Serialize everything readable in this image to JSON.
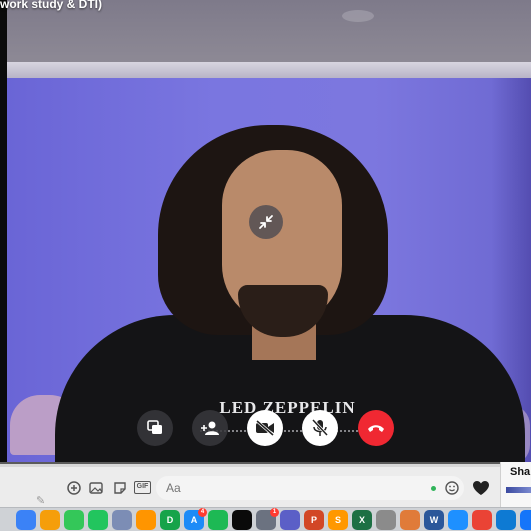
{
  "call": {
    "title_fragment": "work study & DTI)"
  },
  "shirt": {
    "print_text": "LED ZEPPELIN"
  },
  "composer": {
    "placeholder": "Aa"
  },
  "side_panel": {
    "label": "Sha"
  },
  "colors": {
    "end_call": "#f02832",
    "wall": "#7a76e0",
    "online": "#31b45a"
  },
  "dock": {
    "apps": [
      {
        "name": "finder-icon",
        "color": "#3b82f6",
        "glyph": ""
      },
      {
        "name": "photos-icon",
        "color": "#f59e0b",
        "glyph": ""
      },
      {
        "name": "messages-icon",
        "color": "#34c759",
        "glyph": ""
      },
      {
        "name": "facetime-icon",
        "color": "#22c55e",
        "glyph": ""
      },
      {
        "name": "preview-icon",
        "color": "#7c8db5",
        "glyph": ""
      },
      {
        "name": "books-icon",
        "color": "#ff9500",
        "glyph": ""
      },
      {
        "name": "numbers-icon",
        "color": "#16a34a",
        "glyph": "D"
      },
      {
        "name": "app-store-icon",
        "color": "#1d8bf7",
        "glyph": "A",
        "badge": "4"
      },
      {
        "name": "spotify-icon",
        "color": "#1db954",
        "glyph": ""
      },
      {
        "name": "activity-icon",
        "color": "#0a0a0a",
        "glyph": ""
      },
      {
        "name": "system-preferences-icon",
        "color": "#6b7280",
        "glyph": "",
        "badge": "1"
      },
      {
        "name": "teams-icon",
        "color": "#5b5fc7",
        "glyph": ""
      },
      {
        "name": "powerpoint-icon",
        "color": "#d24726",
        "glyph": "P"
      },
      {
        "name": "sublime-icon",
        "color": "#ff9800",
        "glyph": "S"
      },
      {
        "name": "excel-icon",
        "color": "#1d7044",
        "glyph": "X"
      },
      {
        "name": "database-icon",
        "color": "#8b8b8b",
        "glyph": ""
      },
      {
        "name": "migration-icon",
        "color": "#e07b39",
        "glyph": ""
      },
      {
        "name": "word-icon",
        "color": "#2b579a",
        "glyph": "W"
      },
      {
        "name": "safari-icon",
        "color": "#1e90ff",
        "glyph": ""
      },
      {
        "name": "chrome-icon",
        "color": "#ea4335",
        "glyph": ""
      },
      {
        "name": "vscode-icon",
        "color": "#0e7ad3",
        "glyph": ""
      },
      {
        "name": "xcode-icon",
        "color": "#1575f9",
        "glyph": ""
      }
    ]
  }
}
